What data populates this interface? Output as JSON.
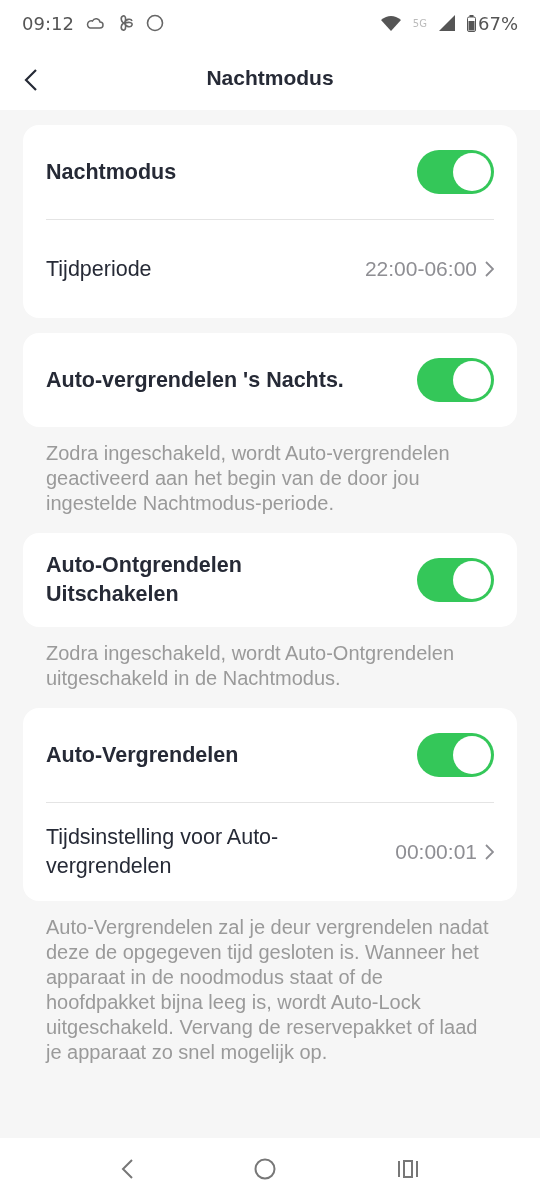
{
  "status_bar": {
    "time": "09:12",
    "network": "5G",
    "battery": "67%"
  },
  "header": {
    "title": "Nachtmodus"
  },
  "sections": [
    {
      "rows": [
        {
          "kind": "toggle",
          "label": "Nachtmodus",
          "on": true
        },
        {
          "kind": "link",
          "label": "Tijdperiode",
          "value": "22:00-06:00"
        }
      ]
    },
    {
      "rows": [
        {
          "kind": "toggle",
          "label": "Auto-vergrendelen 's Nachts.",
          "on": true
        }
      ],
      "note": "Zodra ingeschakeld, wordt Auto-vergrendelen geactiveerd aan het begin van de door jou ingestelde Nachtmodus-periode."
    },
    {
      "rows": [
        {
          "kind": "toggle",
          "label": "Auto-Ontgrendelen Uitschakelen",
          "on": true
        }
      ],
      "note": "Zodra ingeschakeld, wordt Auto-Ontgrendelen uitgeschakeld in de Nachtmodus."
    },
    {
      "rows": [
        {
          "kind": "toggle",
          "label": "Auto-Vergrendelen",
          "on": true
        },
        {
          "kind": "link",
          "label": "Tijdsinstelling voor Auto-vergrendelen",
          "value": "00:00:01"
        }
      ],
      "note": "Auto-Vergrendelen zal je deur vergrendelen nadat deze de opgegeven tijd gesloten is. Wanneer het apparaat in de noodmodus staat of de hoofdpakket bijna leeg is, wordt Auto-Lock uitgeschakeld. Vervang de reservepakket of laad je apparaat zo snel mogelijk op."
    }
  ]
}
